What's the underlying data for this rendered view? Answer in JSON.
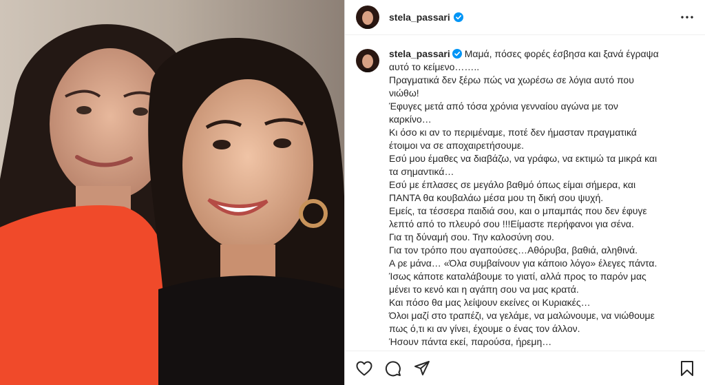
{
  "post": {
    "username": "stela_passari",
    "verified": true,
    "photo_alt": "selfie-of-two-women",
    "caption_lines": [
      "Μαμά, πόσες φορές έσβησα και ξανά έγραψα",
      "αυτό το κείμενο……..",
      "Πραγματικά δεν ξέρω πώς να χωρέσω σε λόγια αυτό που",
      "νιώθω!",
      "Έφυγες μετά από τόσα χρόνια γενναίου αγώνα με τον",
      "καρκίνο…",
      "Κι όσο κι αν το περιμέναμε, ποτέ δεν ήμασταν πραγματικά",
      "έτοιμοι να σε αποχαιρετήσουμε.",
      "Εσύ μου έμαθες να διαβάζω, να γράφω, να εκτιμώ τα μικρά και",
      "τα σημαντικά…",
      "Εσύ με έπλασες σε μεγάλο βαθμό όπως είμαι σήμερα, και",
      "ΠΑΝΤΑ θα κουβαλάω μέσα μου τη δική σου ψυχή.",
      "Εμείς, τα τέσσερα παιδιά σου, και ο μπαμπάς που δεν έφυγε",
      "λεπτό από το πλευρό σου !!!Είμαστε περήφανοι για σένα.",
      "Για τη δύναμή σου. Την καλοσύνη σου.",
      "Για τον τρόπο που αγαπούσες…Αθόρυβα, βαθιά, αληθινά.",
      "Α ρε μάνα… «Όλα συμβαίνουν για κάποιο λόγο» έλεγες πάντα.",
      "Ίσως κάποτε καταλάβουμε το γιατί, αλλά προς το παρόν μας",
      "μένει το κενό και η αγάπη σου να μας κρατά.",
      "Και πόσο θα μας λείψουν εκείνες οι Κυριακές…",
      "Όλοι μαζί στο τραπέζι, να γελάμε, να μαλώνουμε, να νιώθουμε",
      "πως ό,τι κι αν γίνει, έχουμε ο ένας τον άλλον.",
      "Ήσουν πάντα εκεί, παρούσα, ήρεμη…"
    ]
  },
  "icons": {
    "verified": "verified-badge-icon",
    "more": "more-options-icon",
    "like": "heart-icon",
    "comment": "comment-icon",
    "share": "share-icon",
    "save": "bookmark-icon"
  },
  "colors": {
    "verified": "#0095f6",
    "text": "#262626",
    "border": "#dbdbdb"
  }
}
